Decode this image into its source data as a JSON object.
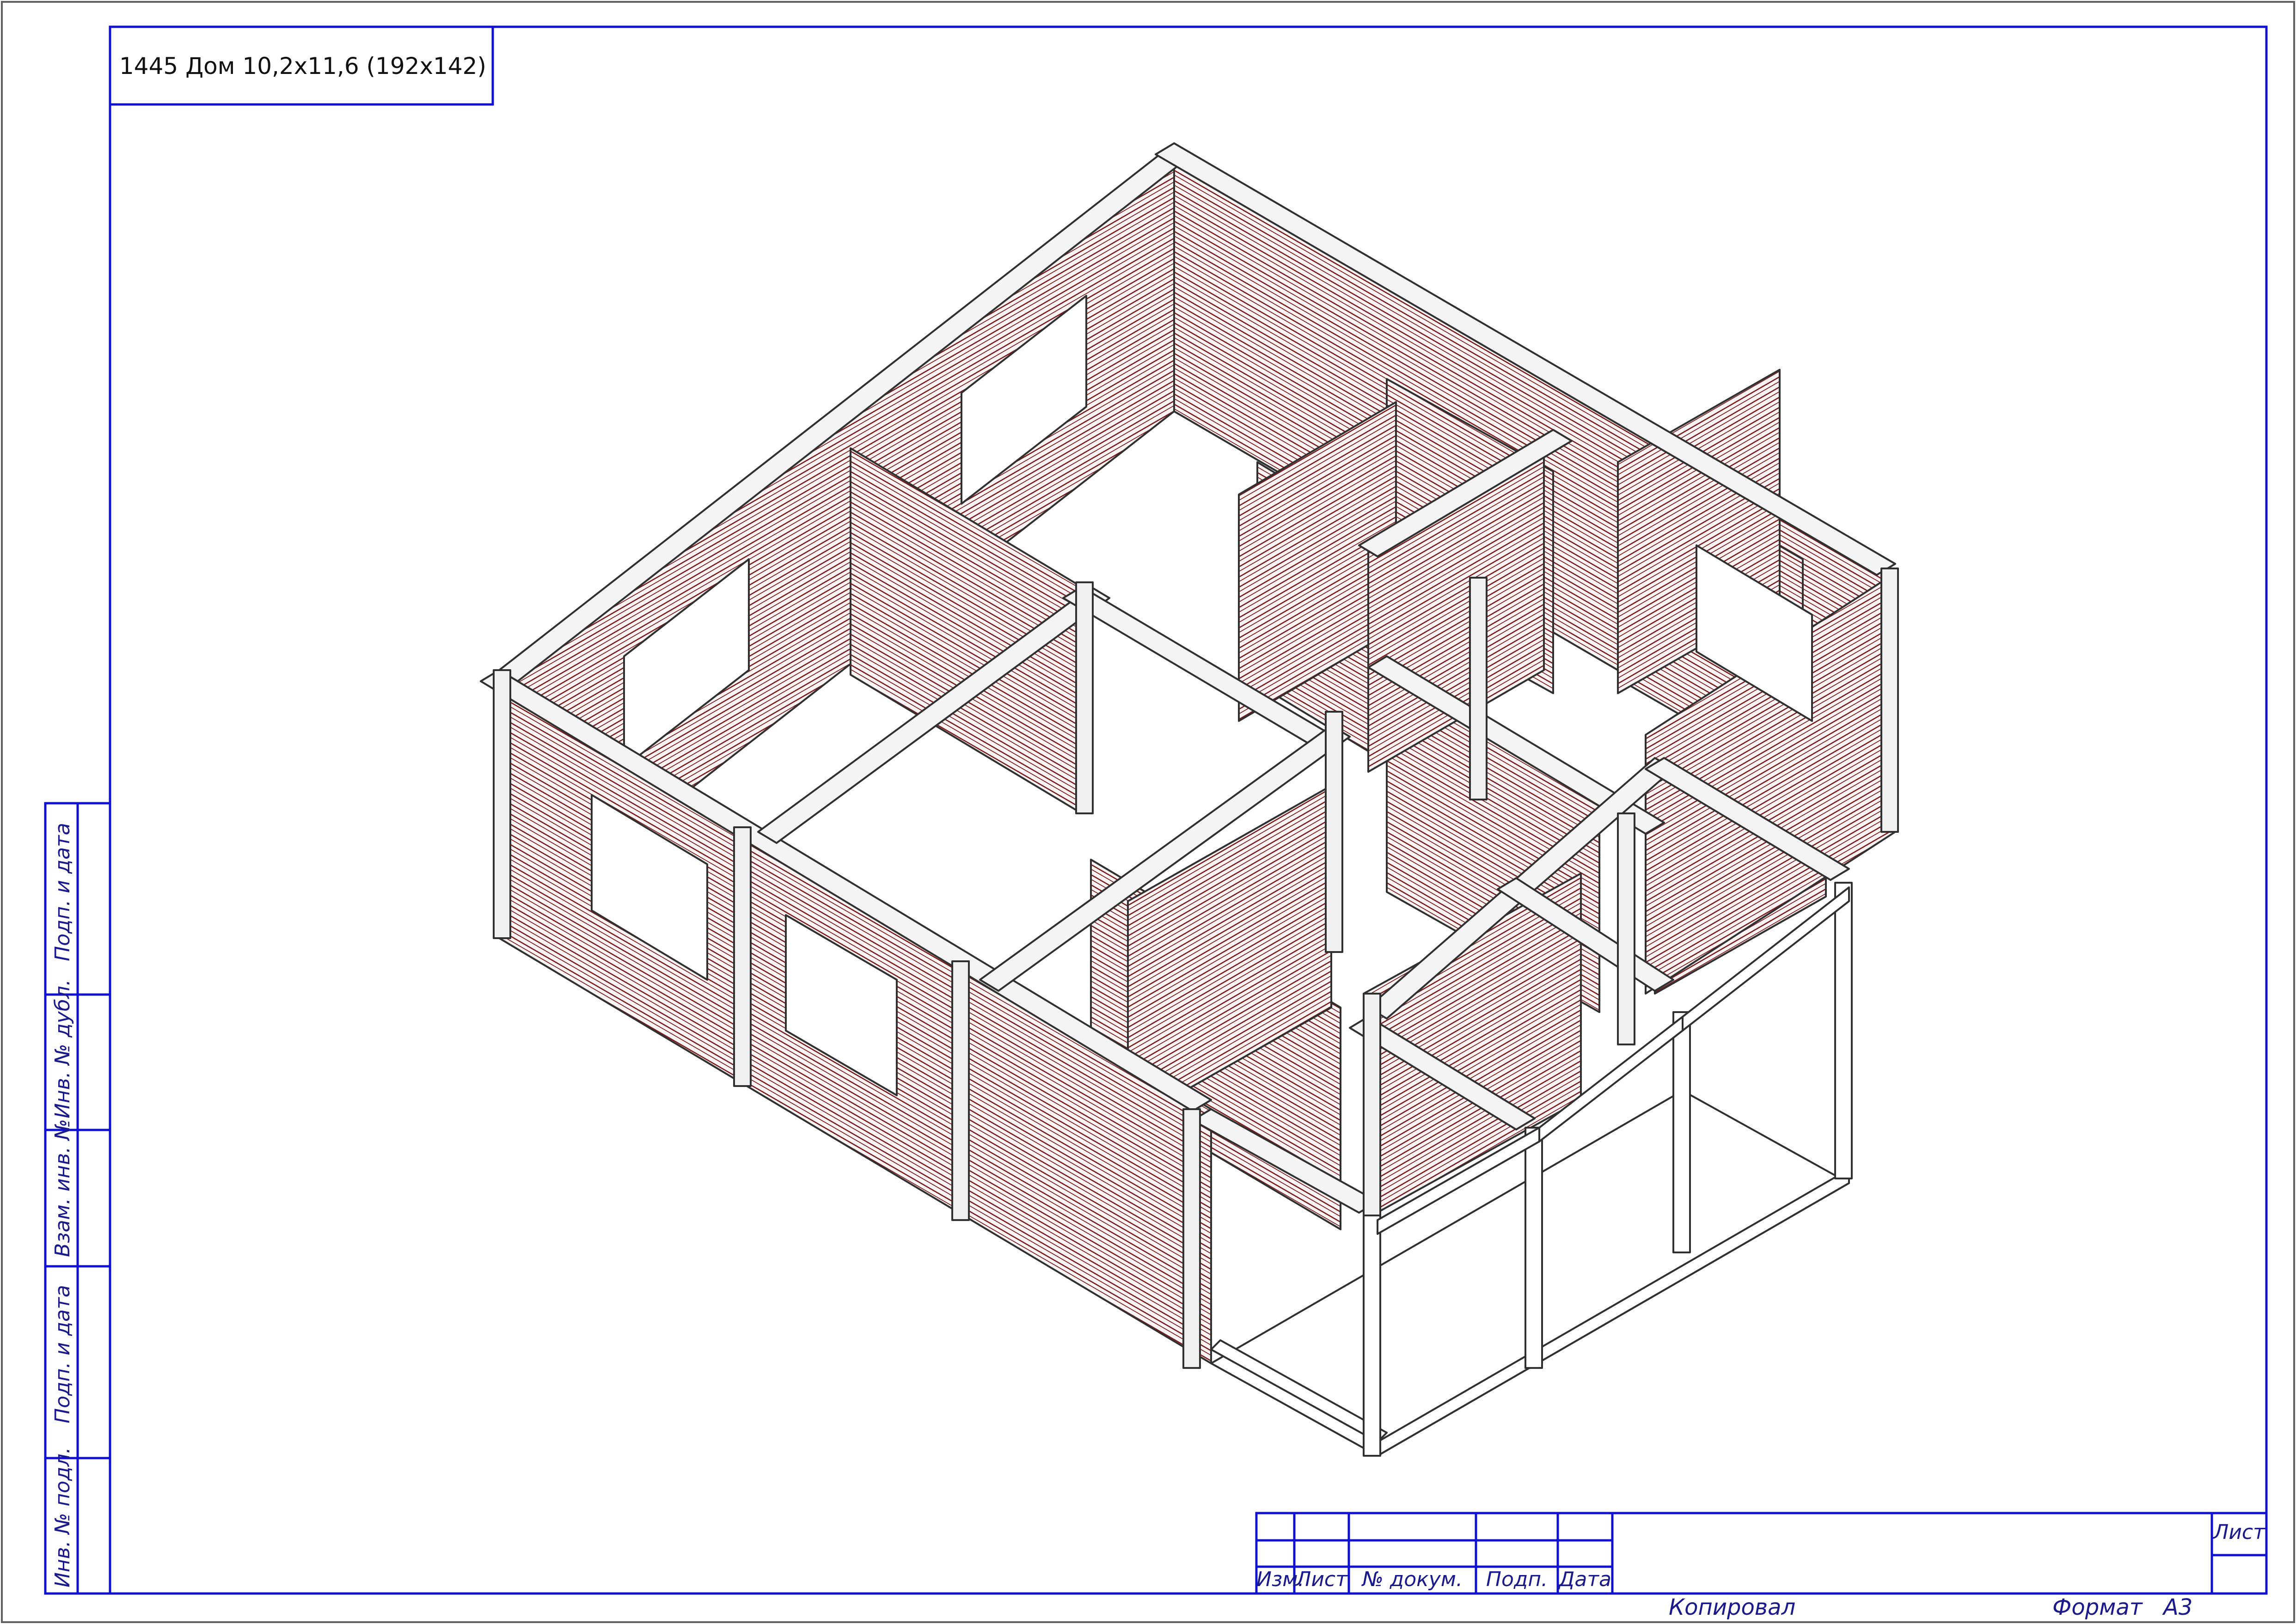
{
  "title": "1445 Дом 10,2x11,6 (192x142)",
  "side_labels": [
    "Подп. и дата",
    "Инв. № дубл.",
    "Взам. инв. №",
    "Подп. и дата",
    "Инв. № подл."
  ],
  "stamp": {
    "izm": "Изм.",
    "list": "Лист",
    "doc_no": "№ докум.",
    "podp": "Подп.",
    "data": "Дата",
    "sheet": "Лист"
  },
  "footer": {
    "copied": "Копировал",
    "format_label": "Формат",
    "format_value": "А3"
  },
  "colors": {
    "frame": "#1010d0",
    "logs": "#7a1a1a",
    "edges": "#303030"
  }
}
